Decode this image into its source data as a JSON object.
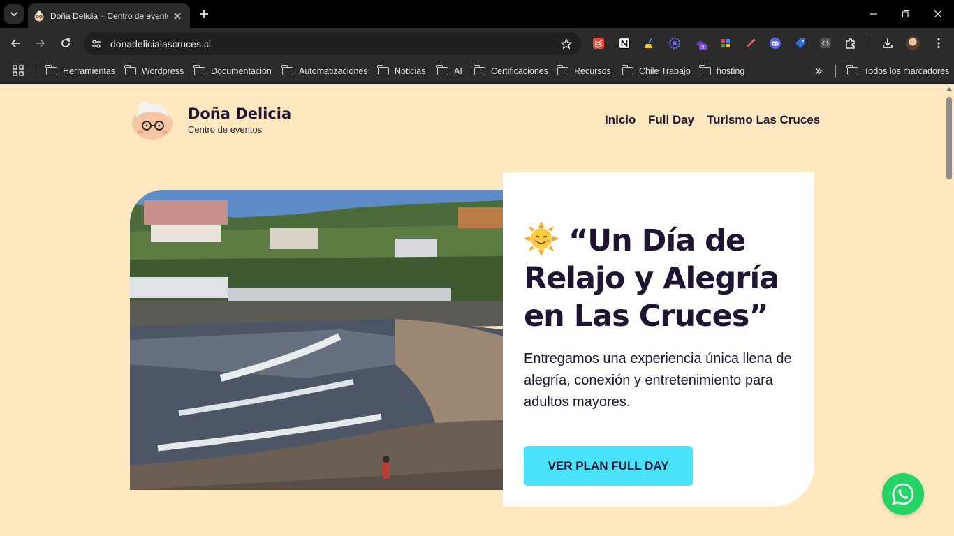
{
  "browser": {
    "tab": {
      "title": "Doña Delicia – Centro de eventos",
      "favicon": "granny-face-icon"
    },
    "address": {
      "url": "donadelicialascruces.cl"
    },
    "extensions": [
      {
        "name": "todoist-icon",
        "color": "#e44332"
      },
      {
        "name": "notion-icon",
        "color": "#ffffff"
      },
      {
        "name": "broom-icon",
        "color": "#4a7ef0"
      },
      {
        "name": "gear-flower-icon",
        "color": "#5b5bf0"
      },
      {
        "name": "hat-icon",
        "color": "#6a3fd6",
        "badge": "9"
      },
      {
        "name": "google-colors-icon",
        "color": "#34a853"
      },
      {
        "name": "pen-icon",
        "color": "#e05a6a"
      },
      {
        "name": "robot-icon",
        "color": "#5865f2"
      },
      {
        "name": "tag-icon",
        "color": "#2f6fde"
      },
      {
        "name": "code-icon",
        "color": "#bbbbbb"
      },
      {
        "name": "puzzle-icon",
        "color": "#e3e3e3"
      }
    ],
    "bookmarks": [
      "Herramientas",
      "Wordpress",
      "Documentación",
      "Automatizaciones",
      "Noticias",
      "AI",
      "Certificaciones",
      "Recursos",
      "Chile Trabajo",
      "hosting"
    ],
    "all_bookmarks": "Todos los marcadores"
  },
  "site": {
    "brand": {
      "name": "Doña Delicia",
      "subtitle": "Centro de eventos"
    },
    "nav": [
      "Inicio",
      "Full Day",
      "Turismo Las Cruces"
    ],
    "hero": {
      "title": "“Un Día de Relajo y Alegría en Las Cruces”",
      "text": "Entregamos una experiencia única llena de alegría, conexión y entretenimiento para adultos mayores.",
      "cta": "VER PLAN FULL DAY"
    },
    "colors": {
      "background": "#ffe8bf",
      "cta": "#49e3fb",
      "text": "#1f1533",
      "whatsapp": "#25d366"
    }
  }
}
